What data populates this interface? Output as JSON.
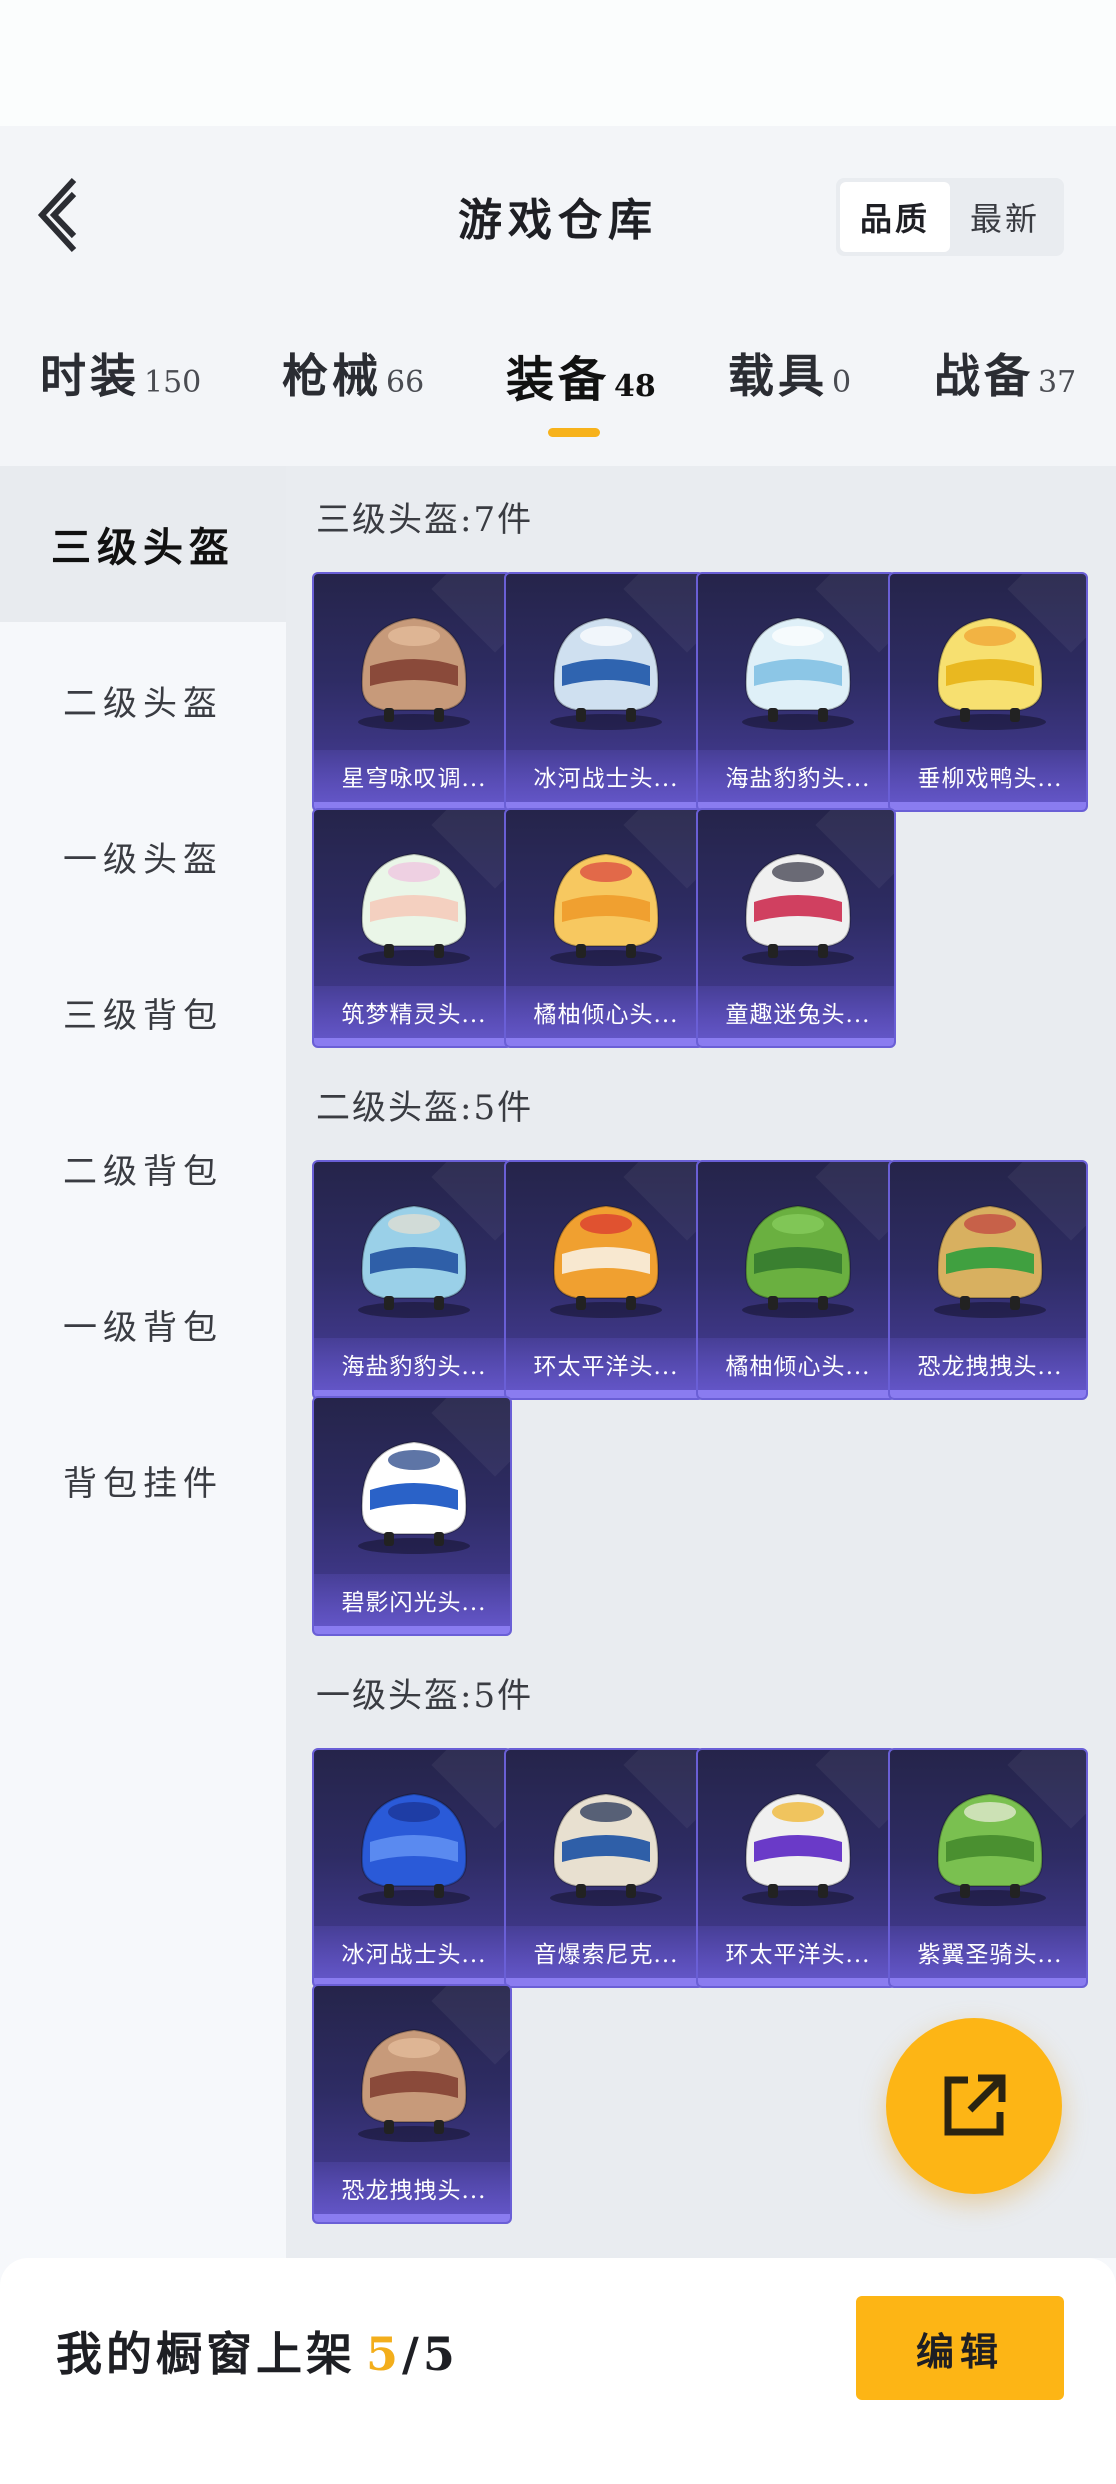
{
  "header": {
    "title": "游戏仓库",
    "back_icon": "chevron-left-icon"
  },
  "sort": {
    "options": [
      "品质",
      "最新"
    ],
    "selected": "品质"
  },
  "tabs": [
    {
      "label": "时装",
      "count": "150"
    },
    {
      "label": "枪械",
      "count": "66"
    },
    {
      "label": "装备",
      "count": "48",
      "active": true
    },
    {
      "label": "载具",
      "count": "0"
    },
    {
      "label": "战备",
      "count": "37"
    }
  ],
  "sidebar": {
    "items": [
      "三级头盔",
      "二级头盔",
      "一级头盔",
      "三级背包",
      "二级背包",
      "一级背包",
      "背包挂件"
    ],
    "active": "三级头盔"
  },
  "groups": [
    {
      "title": "三级头盔:7件",
      "items": [
        "星穹咏叹调...",
        "冰河战士头...",
        "海盐豹豹头...",
        "垂柳戏鸭头...",
        "筑梦精灵头...",
        "橘柚倾心头...",
        "童趣迷兔头..."
      ]
    },
    {
      "title": "二级头盔:5件",
      "items": [
        "海盐豹豹头...",
        "环太平洋头...",
        "橘柚倾心头...",
        "恐龙拽拽头...",
        "碧影闪光头..."
      ]
    },
    {
      "title": "一级头盔:5件",
      "items": [
        "冰河战士头...",
        "音爆索尼克...",
        "环太平洋头...",
        "紫翼圣骑头...",
        "恐龙拽拽头..."
      ]
    }
  ],
  "fab": {
    "icon": "share-external-icon"
  },
  "bottom": {
    "prefix": "我的橱窗上架",
    "shown": "5",
    "total": "/5",
    "edit_label": "编辑"
  },
  "colors": {
    "accent": "#fdb515",
    "card_bg": "#2e2c64",
    "card_border": "#6a5fd6"
  }
}
